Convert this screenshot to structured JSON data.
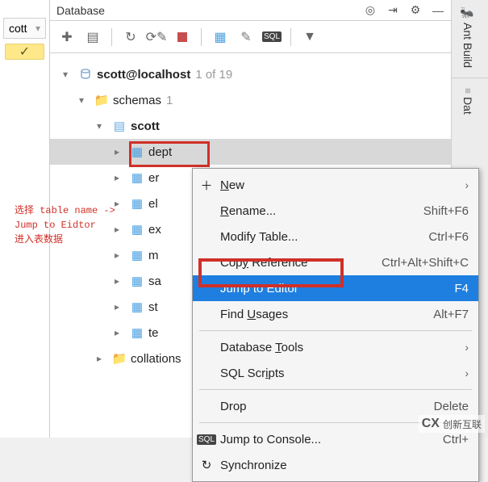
{
  "left": {
    "dd_label": "cott",
    "yellow_icon": "✓"
  },
  "panel": {
    "title": "Database"
  },
  "tree": {
    "root": "scott@localhost",
    "root_count": "1 of 19",
    "schemas": {
      "label": "schemas",
      "count": "1"
    },
    "db": "scott",
    "tables": [
      "dept",
      "er",
      "el",
      "ex",
      "m",
      "sa",
      "st",
      "te"
    ],
    "collations": "collations"
  },
  "annotation": "选择 table name ->\nJump to Eidtor\n进入表数据",
  "menu": {
    "new": "New",
    "rename": "Rename...",
    "rename_sc": "Shift+F6",
    "modify": "Modify Table...",
    "modify_sc": "Ctrl+F6",
    "copyref": "Copy Reference",
    "copyref_sc": "Ctrl+Alt+Shift+C",
    "jump": "Jump to Editor",
    "jump_sc": "F4",
    "find": "Find Usages",
    "find_sc": "Alt+F7",
    "dbtools": "Database Tools",
    "sql": "SQL Scripts",
    "drop": "Drop",
    "drop_sc": "Delete",
    "console": "Jump to Console...",
    "console_sc": "Ctrl+",
    "sync": "Synchronize"
  },
  "rtabs": {
    "ant": "Ant Build",
    "data": "Dat"
  },
  "logo": {
    "cx": "CX",
    "txt": "创新互联"
  }
}
